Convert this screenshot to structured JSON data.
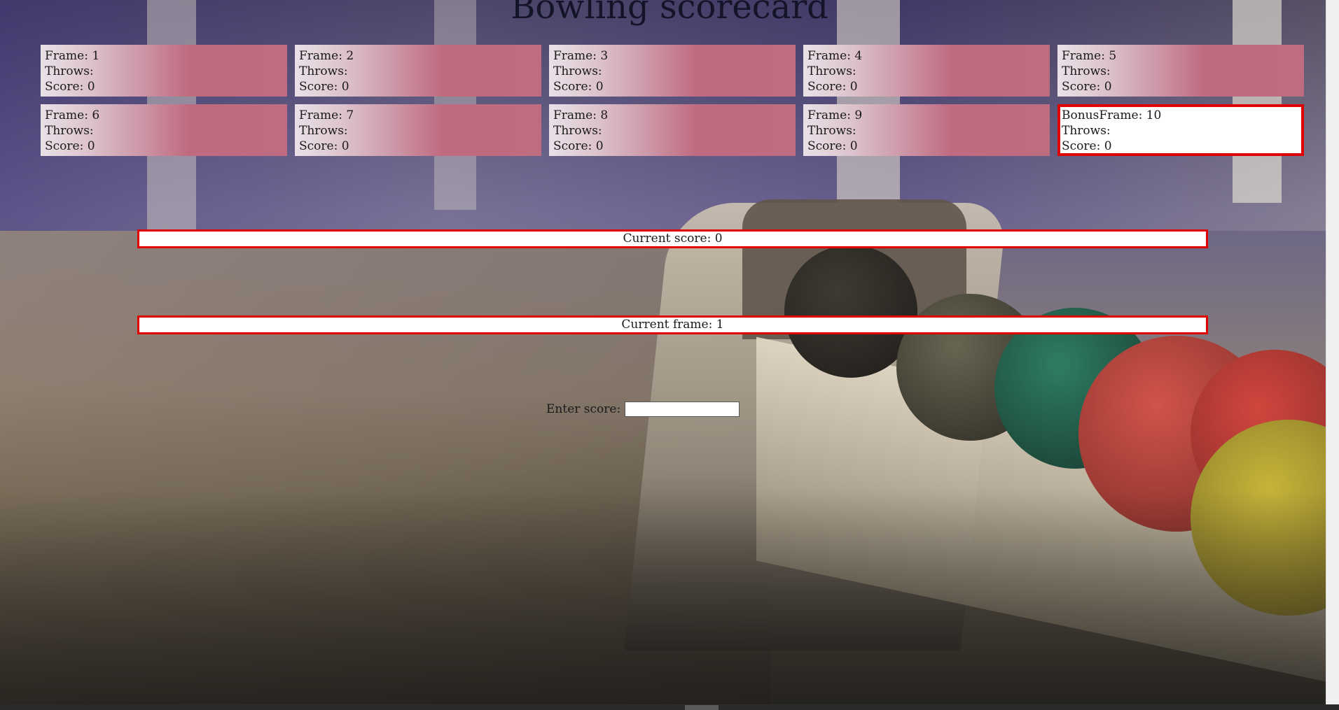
{
  "page": {
    "title": "Bowling scorecard"
  },
  "frames": [
    {
      "label": "Frame: 1",
      "throws": "Throws:",
      "score": "Score:  0"
    },
    {
      "label": "Frame: 2",
      "throws": "Throws:",
      "score": "Score:  0"
    },
    {
      "label": "Frame: 3",
      "throws": "Throws:",
      "score": "Score:  0"
    },
    {
      "label": "Frame: 4",
      "throws": "Throws:",
      "score": "Score:  0"
    },
    {
      "label": "Frame: 5",
      "throws": "Throws:",
      "score": "Score:  0"
    },
    {
      "label": "Frame: 6",
      "throws": "Throws:",
      "score": "Score:  0"
    },
    {
      "label": "Frame: 7",
      "throws": "Throws:",
      "score": "Score:  0"
    },
    {
      "label": "Frame: 8",
      "throws": "Throws:",
      "score": "Score:  0"
    },
    {
      "label": "Frame: 9",
      "throws": "Throws:",
      "score": "Score:  0"
    },
    {
      "label": "BonusFrame: 10",
      "throws": "Throws:",
      "score": "Score:  0"
    }
  ],
  "status": {
    "current_score": "Current score: 0",
    "current_frame": "Current frame: 1"
  },
  "entry": {
    "label": "Enter score:",
    "value": ""
  },
  "colors": {
    "highlight_border": "#e00000",
    "frame_gradient_end": "#bf6b80"
  }
}
